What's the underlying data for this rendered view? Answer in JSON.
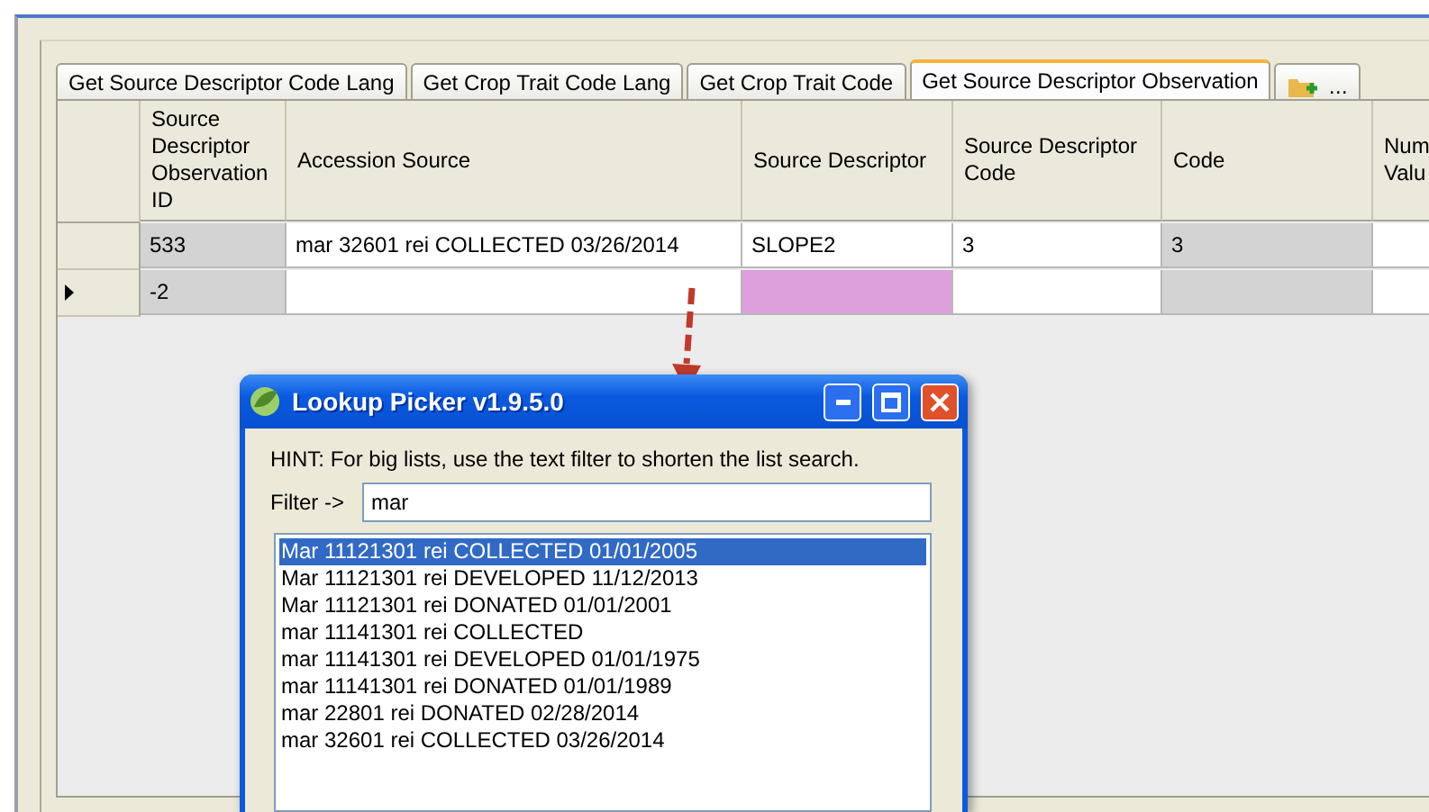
{
  "tabs": [
    {
      "label": "Get Source Descriptor Code Lang",
      "selected": false
    },
    {
      "label": "Get Crop Trait Code Lang",
      "selected": false
    },
    {
      "label": "Get Crop Trait Code",
      "selected": false
    },
    {
      "label": "Get Source Descriptor Observation",
      "selected": true
    }
  ],
  "new_tab": {
    "label": "..."
  },
  "table": {
    "columns": [
      "Source Descriptor Observation ID",
      "Accession Source",
      "Source Descriptor",
      "Source Descriptor Code",
      "Code",
      "Num Valu"
    ],
    "rows": [
      {
        "current": false,
        "cells": [
          {
            "text": "533",
            "kind": "readonly"
          },
          {
            "text": "mar 32601 rei COLLECTED 03/26/2014",
            "kind": "editable"
          },
          {
            "text": "SLOPE2",
            "kind": "editable"
          },
          {
            "text": "3",
            "kind": "editable"
          },
          {
            "text": "3",
            "kind": "readonly"
          },
          {
            "kind": "editable"
          }
        ]
      },
      {
        "current": true,
        "cells": [
          {
            "text": "-2",
            "kind": "readonly"
          },
          {
            "kind": "editable"
          },
          {
            "kind": "required"
          },
          {
            "kind": "editable"
          },
          {
            "kind": "readonly"
          },
          {
            "kind": "editable"
          }
        ]
      }
    ]
  },
  "dialog": {
    "title": "Lookup Picker v1.9.5.0",
    "hint": "HINT: For big lists, use the text filter to shorten the list search.",
    "filter_label": "Filter ->",
    "filter_value": "mar",
    "items": [
      {
        "text": "Mar 11121301 rei COLLECTED 01/01/2005",
        "selected": true
      },
      {
        "text": "Mar 11121301 rei DEVELOPED 11/12/2013",
        "selected": false
      },
      {
        "text": "Mar 11121301 rei DONATED 01/01/2001",
        "selected": false
      },
      {
        "text": "mar 11141301 rei COLLECTED",
        "selected": false
      },
      {
        "text": "mar 11141301 rei DEVELOPED 01/01/1975",
        "selected": false
      },
      {
        "text": "mar 11141301 rei DONATED 01/01/1989",
        "selected": false
      },
      {
        "text": "mar 22801 rei DONATED 02/28/2014",
        "selected": false
      },
      {
        "text": "mar 32601 rei COLLECTED 03/26/2014",
        "selected": false
      }
    ]
  }
}
